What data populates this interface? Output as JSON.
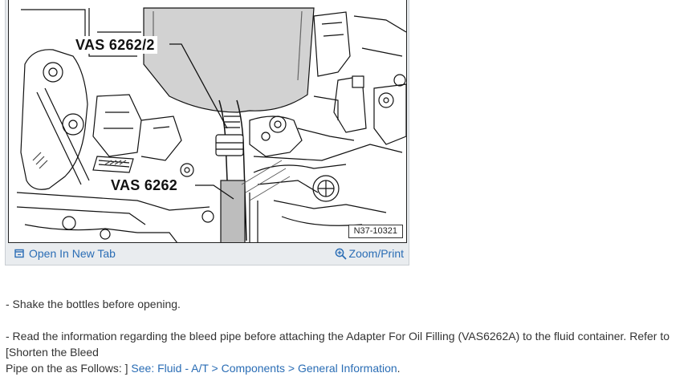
{
  "figure": {
    "callouts": [
      "VAS 6262/2",
      "VAS 6262"
    ],
    "ref_number": "N37-10321"
  },
  "actions": {
    "open_new_tab": "Open In New Tab",
    "zoom_print": "Zoom/Print"
  },
  "content": {
    "step1": "- Shake the bottles before opening.",
    "step2_text": "- Read the information regarding the bleed pipe before attaching the Adapter For Oil Filling (VAS6262A) to the fluid container. Refer to [Shorten the Bleed",
    "step2_text_line2": "Pipe on the as Follows: ]",
    "link": "See: Fluid - A/T > Components > General Information",
    "link_suffix": "."
  },
  "colors": {
    "link": "#2a6db5",
    "panel_bg": "#e9ecef",
    "text": "#333333"
  }
}
